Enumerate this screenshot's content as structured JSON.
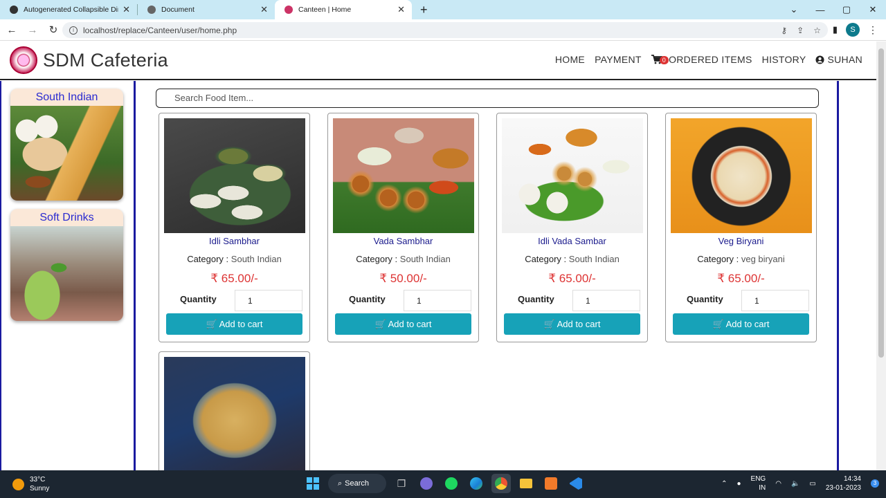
{
  "browser": {
    "tabs": [
      {
        "title": "Autogenerated Collapsible Direct"
      },
      {
        "title": "Document"
      },
      {
        "title": "Canteen | Home"
      }
    ],
    "url": "localhost/replace/Canteen/user/home.php",
    "profile_initial": "S",
    "window_controls": {
      "minimize": "—",
      "maximize": "▢",
      "close": "✕"
    }
  },
  "site": {
    "brand": "SDM Cafeteria",
    "nav": {
      "home": "HOME",
      "payment": "PAYMENT",
      "cart_count": "0",
      "ordered_items": "ORDERED ITEMS",
      "history": "HISTORY",
      "user": "SUHAN"
    }
  },
  "sidebar": {
    "categories": [
      {
        "label": "South Indian"
      },
      {
        "label": "Soft Drinks"
      }
    ]
  },
  "main": {
    "search_placeholder": "Search Food Item...",
    "category_label": "Category :",
    "quantity_label": "Quantity",
    "add_label": "Add to cart",
    "items": [
      {
        "name": "Idli Sambhar",
        "category": "South Indian",
        "price": "₹ 65.00/-",
        "qty": "1"
      },
      {
        "name": "Vada Sambhar",
        "category": "South Indian",
        "price": "₹ 50.00/-",
        "qty": "1"
      },
      {
        "name": "Idli Vada Sambar",
        "category": "South Indian",
        "price": "₹ 65.00/-",
        "qty": "1"
      },
      {
        "name": "Veg Biryani",
        "category": "veg biryani",
        "price": "₹ 65.00/-",
        "qty": "1"
      }
    ]
  },
  "taskbar": {
    "temp": "33°C",
    "condition": "Sunny",
    "search": "Search",
    "lang1": "ENG",
    "lang2": "IN",
    "time": "14:34",
    "date": "23-01-2023",
    "notifications": "3"
  }
}
